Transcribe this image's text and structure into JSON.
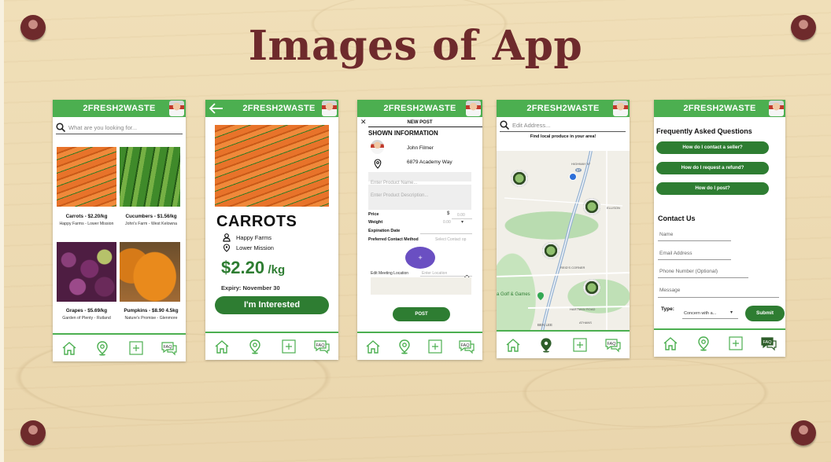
{
  "slide": {
    "title": "Images of App"
  },
  "app": {
    "name": "2FRESH2WASTE"
  },
  "navbar": {
    "icons": [
      "home-icon",
      "map-pin-icon",
      "plus-icon",
      "faq-icon"
    ],
    "faq_label": "FAQ"
  },
  "screen1": {
    "search_placeholder": "What are you looking for...",
    "products": [
      {
        "title": "Carrots - $2.20/kg",
        "subtitle": "Happy Farms - Lower Mission"
      },
      {
        "title": "Cucumbers - $1.56/kg",
        "subtitle": "John's Farm - West Kelowna"
      },
      {
        "title": "Grapes - $5.69/kg",
        "subtitle": "Garden of Plenty - Rutland"
      },
      {
        "title": "Pumpkins - $8.90 4.5kg",
        "subtitle": "Nature's Promise - Glenmore"
      }
    ]
  },
  "screen2": {
    "product_name": "CARROTS",
    "farm": "Happy Farms",
    "location": "Lower Mission",
    "price": "$2.20",
    "unit": "/kg",
    "expiry": "Expiry: November 30",
    "interested_label": "I'm Interested"
  },
  "screen3": {
    "header": "NEW POST",
    "section_title": "SHOWN INFORMATION",
    "user_name": "John Filmer",
    "address": "6879 Academy Way",
    "product_name_placeholder": "Enter Product Name...",
    "product_desc_placeholder": "Enter Product Description...",
    "price_label": "Price",
    "price_value": "0.00",
    "weight_label": "Weight",
    "weight_value": "0.00",
    "expiration_label": "Expiration Date",
    "contact_label": "Preferred Contact Method",
    "contact_placeholder": "Select Contact op",
    "add_image_label": "+",
    "meeting_label": "Edit Meeting Location",
    "location_placeholder": "Enter Location",
    "post_label": "POST"
  },
  "screen4": {
    "address_placeholder": "Edit Address...",
    "subtitle": "Find local produce in your area!",
    "map_labels": {
      "highway": "HIGHWAY 97",
      "ellison": "ELLISON",
      "reid": "REID'S CORNER",
      "golf": "a Golf & Games",
      "hartman": "HARTMAN ROAD",
      "athans": "ATHANS",
      "ben_lee": "BEN LEE",
      "shield_97": "97"
    }
  },
  "screen5": {
    "faq_title": "Frequently Asked Questions",
    "questions": [
      "How do I contact a seller?",
      "How do I request a refund?",
      "How do I post?"
    ],
    "contact_title": "Contact Us",
    "fields": [
      "Name",
      "Email Address",
      "Phone Number (Optional)",
      "Message"
    ],
    "type_label": "Type:",
    "type_value": "Concern with a...",
    "submit_label": "Submit"
  }
}
